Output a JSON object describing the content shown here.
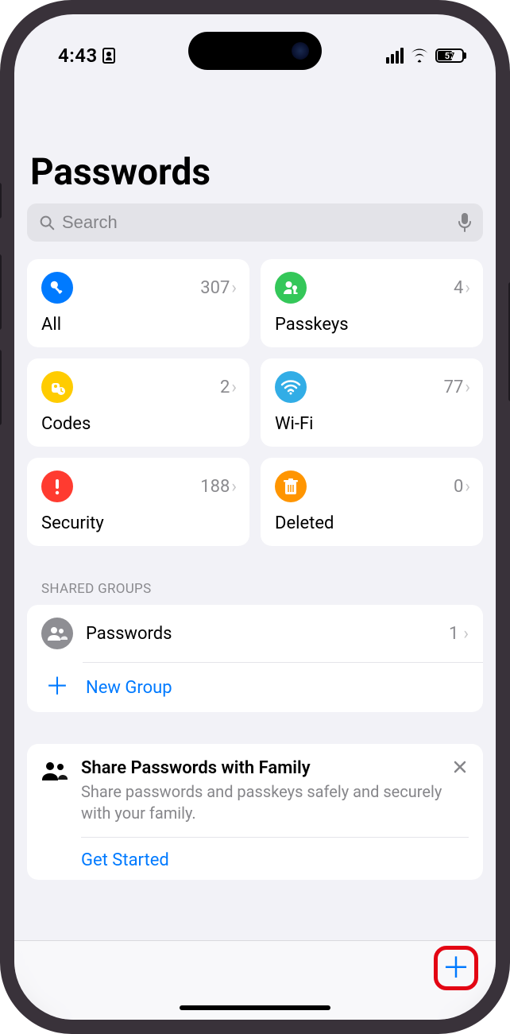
{
  "status": {
    "time": "4:43",
    "battery": "57"
  },
  "page": {
    "title": "Passwords"
  },
  "search": {
    "placeholder": "Search"
  },
  "tiles": {
    "all": {
      "label": "All",
      "count": "307"
    },
    "passkeys": {
      "label": "Passkeys",
      "count": "4"
    },
    "codes": {
      "label": "Codes",
      "count": "2"
    },
    "wifi": {
      "label": "Wi-Fi",
      "count": "77"
    },
    "security": {
      "label": "Security",
      "count": "188"
    },
    "deleted": {
      "label": "Deleted",
      "count": "0"
    }
  },
  "shared": {
    "header": "SHARED GROUPS",
    "group": {
      "name": "Passwords",
      "count": "1"
    },
    "newGroup": "New Group"
  },
  "promo": {
    "title": "Share Passwords with Family",
    "subtitle": "Share passwords and passkeys safely and securely with your family.",
    "cta": "Get Started"
  }
}
